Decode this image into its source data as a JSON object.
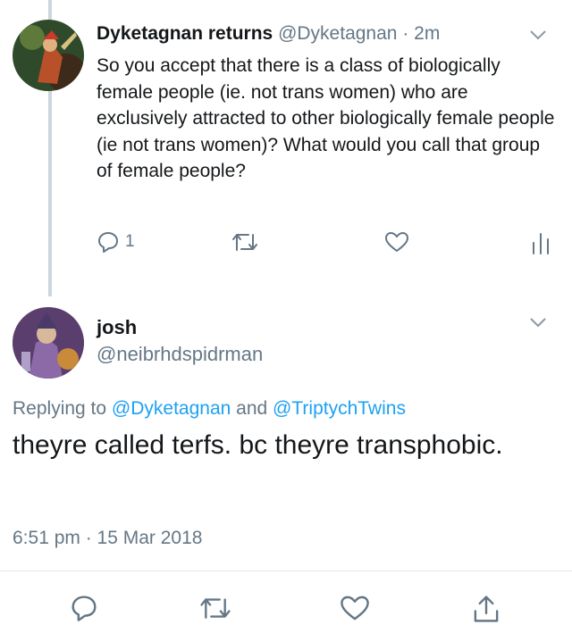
{
  "tweet1": {
    "display_name": "Dyketagnan returns",
    "handle": "@Dyketagnan",
    "separator": "·",
    "age": "2m",
    "text": "So you accept that there is a class of biologically female people (ie. not trans women) who are exclusively attracted to other biologically female people (ie not trans women)? What would you call that group of female people?",
    "reply_count": "1"
  },
  "tweet2": {
    "display_name": "josh",
    "handle": "@neibrhdspidrman",
    "replying_prefix": "Replying to",
    "replying_user1": "@Dyketagnan",
    "replying_and": "and",
    "replying_user2": "@TriptychTwins",
    "text": "theyre called terfs. bc theyre transphobic.",
    "timestamp": "6:51 pm · 15 Mar 2018"
  },
  "colors": {
    "text": "#14171a",
    "secondary": "#657786",
    "link": "#1da1f2",
    "thread_line": "#ccd6dd",
    "divider": "#e1e8ed"
  },
  "icons": [
    "chevron-down-icon",
    "reply-icon",
    "retweet-icon",
    "like-icon",
    "analytics-icon",
    "share-icon"
  ]
}
